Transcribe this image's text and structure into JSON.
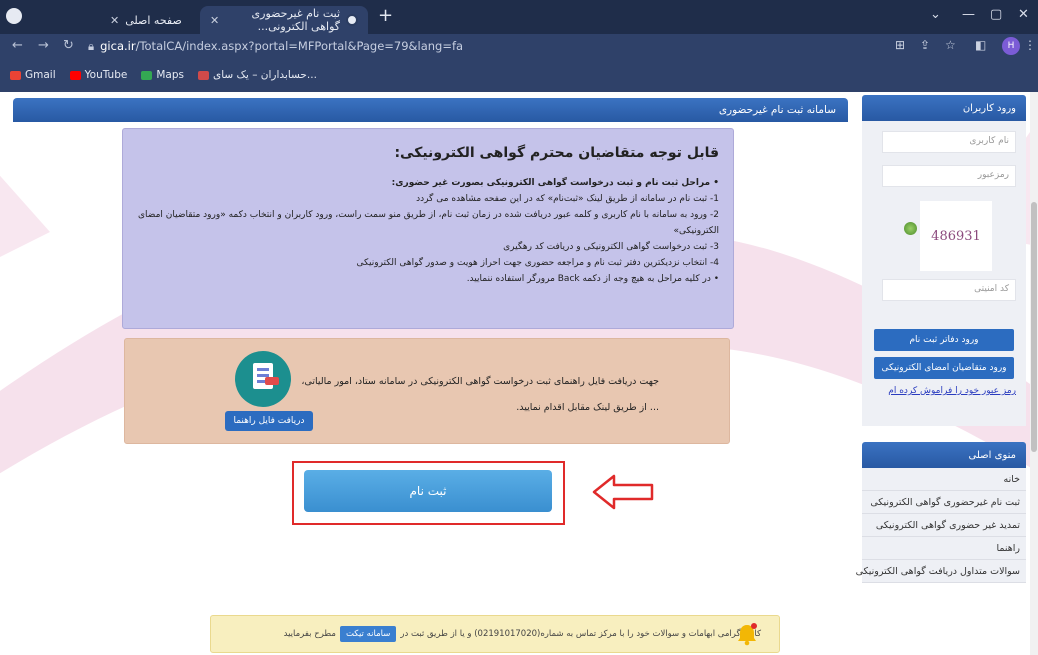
{
  "browser": {
    "tabs": [
      {
        "title": "صفحه اصلی",
        "close": "✕"
      },
      {
        "title": "ثبت نام غیرحضوری گواهی الکترونی...",
        "close": "✕"
      }
    ],
    "new_tab": "+",
    "address": {
      "host": "gica.ir",
      "path": "/TotalCA/index.aspx?portal=MFPortal&Page=79&lang=fa"
    },
    "profile_initial": "H",
    "bookmarks": [
      {
        "label": "Gmail",
        "icon": "gmail-icon",
        "color": "#ea4335"
      },
      {
        "label": "YouTube",
        "icon": "youtube-icon",
        "color": "#ff0000"
      },
      {
        "label": "Maps",
        "icon": "maps-icon",
        "color": "#34a853"
      },
      {
        "label": "حسابداران – یک سای...",
        "icon": "site-icon",
        "color": "#d04a4a"
      }
    ]
  },
  "content": {
    "header_title": "سامانه ثبت نام غیرحضوری",
    "notice": {
      "title": "قابل توجه متقاضیان محترم گواهی الکترونیکی:",
      "items": [
        {
          "text": "مراحل ثبت نام و ثبت درخواست گواهی الکترونیکی بصورت غیر حضوری:",
          "bullet": true,
          "bold": true
        },
        {
          "text": "1- ثبت نام در سامانه از طریق لینک «ثبت‌نام» که در این صفحه مشاهده می گردد",
          "bullet": false,
          "bold": false
        },
        {
          "text": "2- ورود به سامانه با نام کاربری و کلمه عبور دریافت شده در زمان ثبت نام، از طریق منو سمت راست، ورود کاربران و انتخاب دکمه «ورود متقاضیان امضای الکترونیکی»",
          "bullet": false,
          "bold": false
        },
        {
          "text": "3- ثبت درخواست گواهی الکترونیکی و دریافت کد رهگیری",
          "bullet": false,
          "bold": false
        },
        {
          "text": "4- انتخاب نزدیکترین دفتر ثبت نام و مراجعه حضوری جهت احراز هویت و صدور گواهی الکترونیکی",
          "bullet": false,
          "bold": false
        },
        {
          "text": "در کلیه مراحل به هیچ وجه از دکمه Back مرورگر استفاده ننمایید.",
          "bullet": true,
          "bold": false
        }
      ]
    },
    "download": {
      "line1": "جهت دریافت فایل راهنمای ثبت درخواست گواهی الکترونیکی در سامانه ستاد، امور مالیاتی،",
      "line2": "... از طریق لینک مقابل اقدام نمایید.",
      "button": "دریافت فایل راهنما"
    },
    "signup_button": "ثبت نام"
  },
  "sidebar": {
    "login_title": "ورود کاربران",
    "username_placeholder": "نام کاربری",
    "password_placeholder": "رمزعبور",
    "captcha": "486931",
    "security_placeholder": "کد امنیتی",
    "office_login": "ورود دفاتر ثبت نام",
    "applicant_login": "ورود متقاضیان امضای الکترونیکی",
    "forgot_password": "رمز عبور خود را فراموش کرده ام",
    "menu_title": "منوی اصلی",
    "menu_items": [
      "خانه",
      "ثبت نام غیرحضوری گواهی الکترونیکی",
      "تمدید غیر حضوری گواهی الکترونیکی",
      "راهنما",
      "سوالات متداول دریافت گواهی الکترونیکی"
    ]
  },
  "footer": {
    "text_before": "کاربر گرامی ابهامات و سوالات خود را با مرکز تماس به شماره(02191017020) و یا از طریق ثبت در",
    "ticket": "سامانه تیکت",
    "text_after": "مطرح بفرمایید"
  },
  "colors": {
    "header_blue": "#2c6cc0",
    "highlight_red": "#e02a2a",
    "notice_bg": "#c5c3ea",
    "download_bg": "#e8c7b1"
  }
}
